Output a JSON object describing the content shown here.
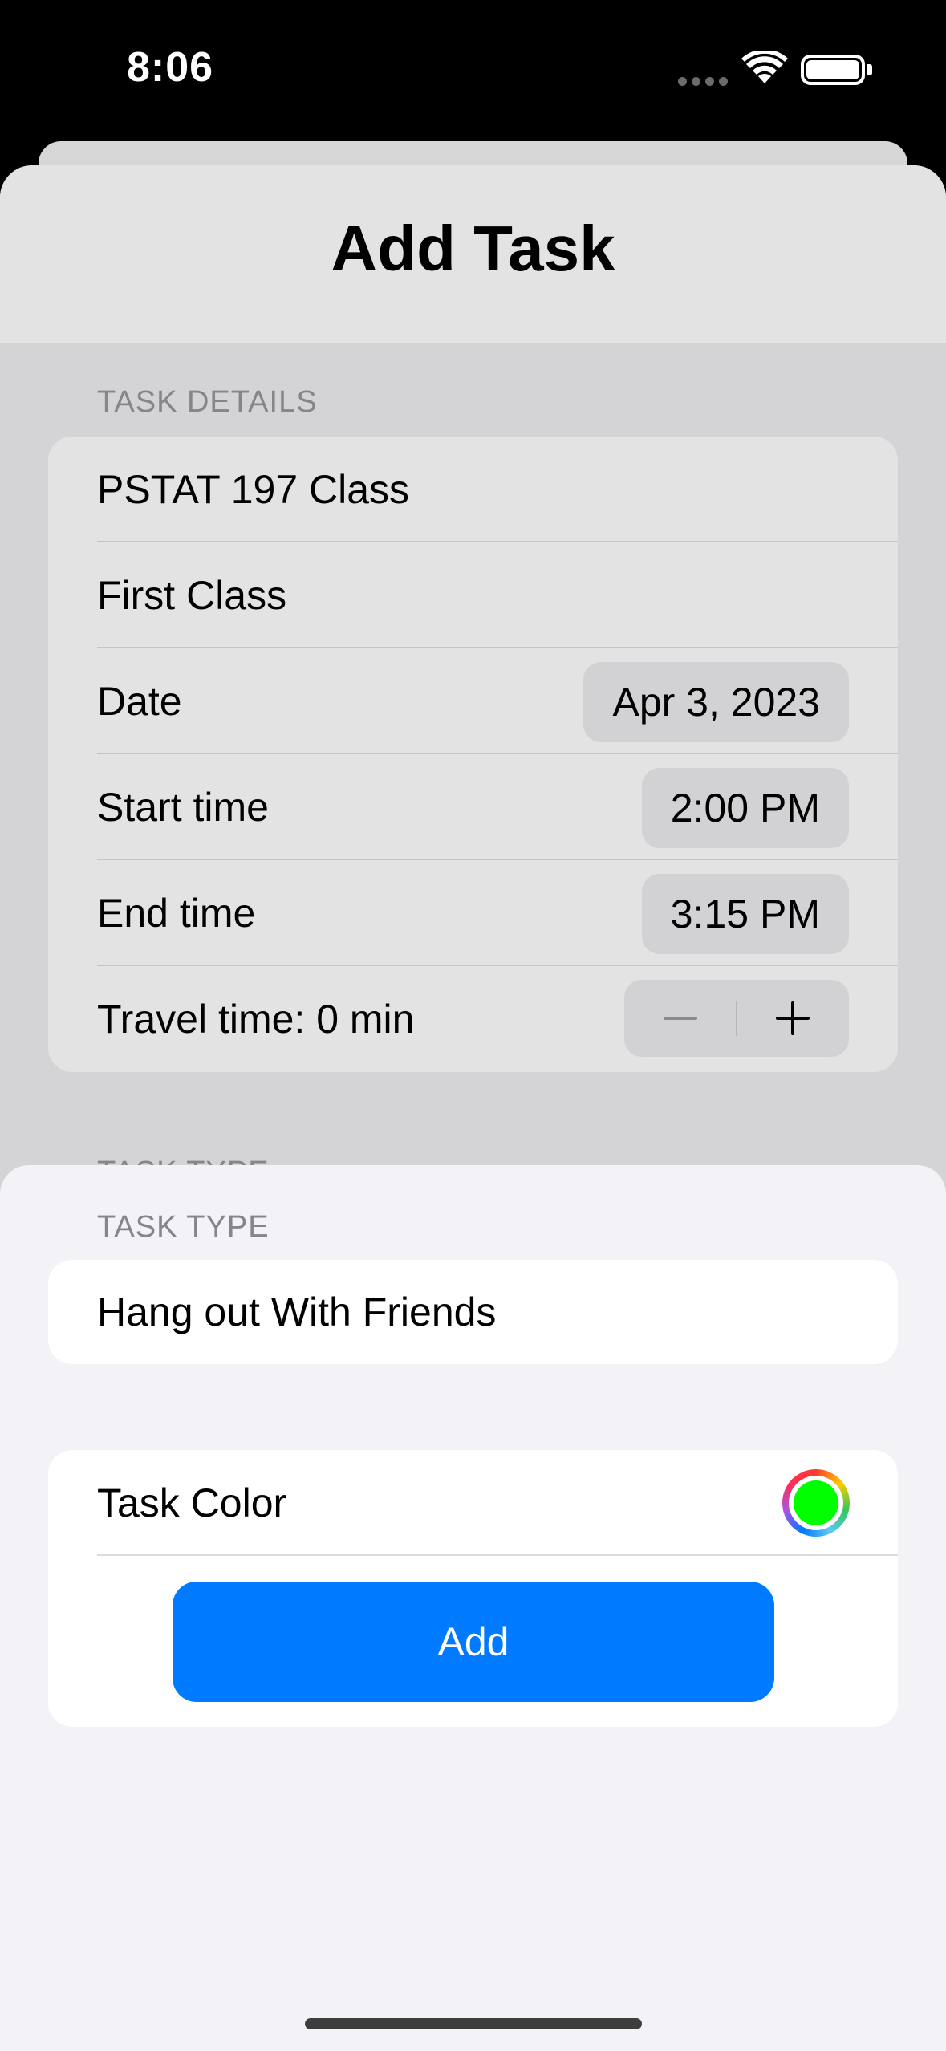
{
  "status_bar": {
    "time": "8:06",
    "icons": [
      "cellular-signal-icon",
      "wifi-icon",
      "battery-icon"
    ]
  },
  "add_task": {
    "title": "Add Task",
    "details_header": "TASK DETAILS",
    "title_field": "PSTAT 197 Class",
    "notes_field": "First Class",
    "date": {
      "label": "Date",
      "value": "Apr 3, 2023"
    },
    "start_time": {
      "label": "Start time",
      "value": "2:00 PM"
    },
    "end_time": {
      "label": "End time",
      "value": "3:15 PM"
    },
    "travel_time": {
      "label": "Travel time: 0 min"
    },
    "task_type_header_partial": "TASK TYPE"
  },
  "task_type_sheet": {
    "header": "TASK TYPE",
    "selected_type": "Hang out With Friends",
    "color_label": "Task Color",
    "selected_color": "#00ff00",
    "add_button_label": "Add"
  },
  "colors": {
    "accent": "#007aff",
    "dim_background": "#d4d4d6",
    "sheet_background": "#f2f2f7"
  }
}
